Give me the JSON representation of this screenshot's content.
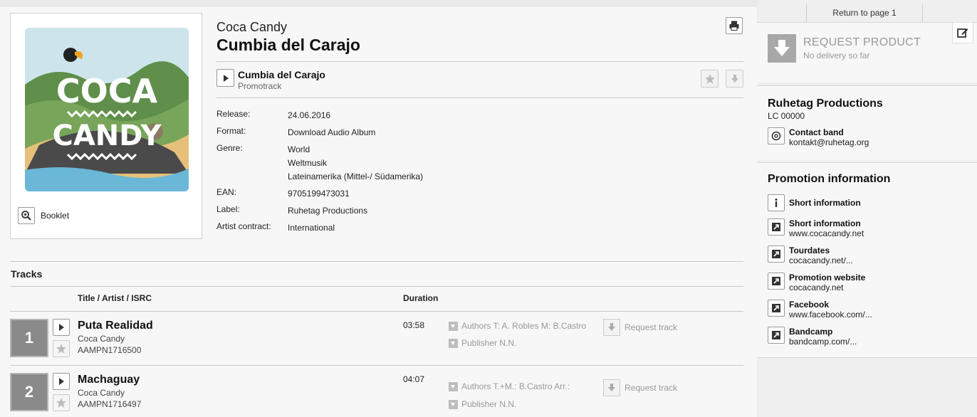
{
  "album": {
    "artist": "Coca Candy",
    "title": "Cumbia del Carajo",
    "cover_text_top": "COCA",
    "cover_text_bottom": "CANDY",
    "booklet_label": "Booklet"
  },
  "promo": {
    "title": "Cumbia del Carajo",
    "subtitle": "Promotrack"
  },
  "meta": [
    {
      "key": "Release:",
      "values": [
        "24.06.2016"
      ]
    },
    {
      "key": "Format:",
      "values": [
        "Download Audio Album"
      ]
    },
    {
      "key": "Genre:",
      "values": [
        "World",
        "Weltmusik",
        "Lateinamerika (Mittel-/ Südamerika)"
      ]
    },
    {
      "key": "EAN:",
      "values": [
        "9705199473031"
      ]
    },
    {
      "key": "Label:",
      "values": [
        "Ruhetag Productions"
      ]
    },
    {
      "key": "Artist contract:",
      "values": [
        "International"
      ]
    }
  ],
  "tracks_section": {
    "heading": "Tracks",
    "col_title": "Title  /  Artist  /  ISRC",
    "col_duration": "Duration",
    "request_label": "Request track"
  },
  "tracks": [
    {
      "num": "1",
      "title": "Puta Realidad",
      "artist": "Coca Candy",
      "isrc": "AAMPN1716500",
      "duration": "03:58",
      "authors": "Authors T: A. Robles M: B.Castro",
      "publisher": "Publisher N.N."
    },
    {
      "num": "2",
      "title": "Machaguay",
      "artist": "Coca Candy",
      "isrc": "AAMPN1716497",
      "duration": "04:07",
      "authors": "Authors T.+M.: B.Castro Arr.:",
      "publisher": "Publisher N.N."
    }
  ],
  "sidebar": {
    "return_link": "Return to page 1",
    "request_title": "REQUEST PRODUCT",
    "request_sub": "No delivery so far",
    "label_name": "Ruhetag Productions",
    "label_code": "LC 00000",
    "contact_title": "Contact band",
    "contact_email": "kontakt@ruhetag.org",
    "promo_heading": "Promotion information",
    "promo_links": [
      {
        "title": "Short information",
        "sub": "",
        "icon": "info-icon"
      },
      {
        "title": "Short information",
        "sub": "www.cocacandy.net",
        "icon": "external-link-icon"
      },
      {
        "title": "Tourdates",
        "sub": "cocacandy.net/...",
        "icon": "external-link-icon"
      },
      {
        "title": "Promotion website",
        "sub": "cocacandy.net",
        "icon": "external-link-icon"
      },
      {
        "title": "Facebook",
        "sub": "www.facebook.com/...",
        "icon": "external-link-icon"
      },
      {
        "title": "Bandcamp",
        "sub": "bandcamp.com/...",
        "icon": "external-link-icon"
      }
    ]
  }
}
